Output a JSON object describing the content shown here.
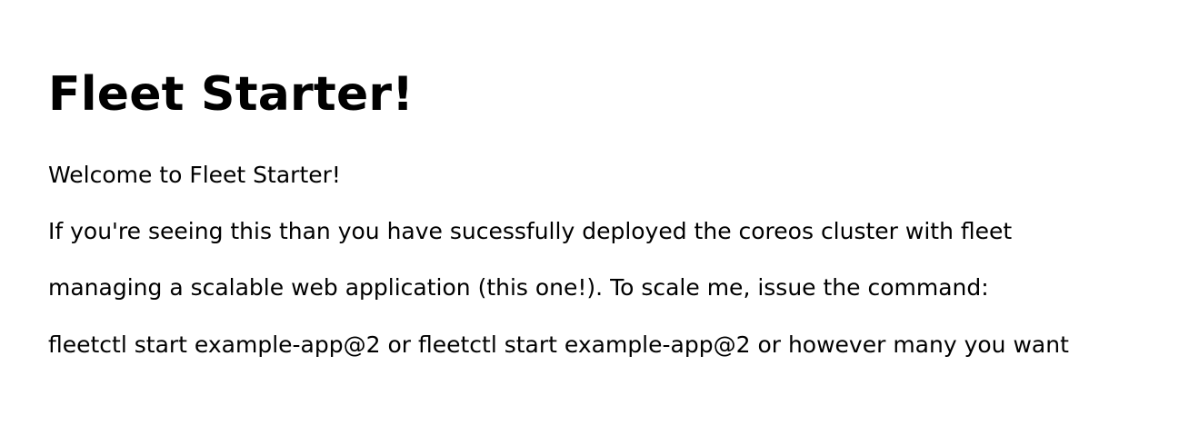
{
  "page": {
    "title": "Fleet Starter!",
    "lines": [
      "Welcome to Fleet Starter!",
      "If you're seeing this than you have sucessfully deployed the coreos cluster with fleet",
      "managing a scalable web application (this one!). To scale me, issue the command:",
      "fleetctl start example-app@2 or fleetctl start example-app@2 or however many you want"
    ]
  },
  "colors": {
    "background": "#ffffff",
    "text": "#000000"
  }
}
